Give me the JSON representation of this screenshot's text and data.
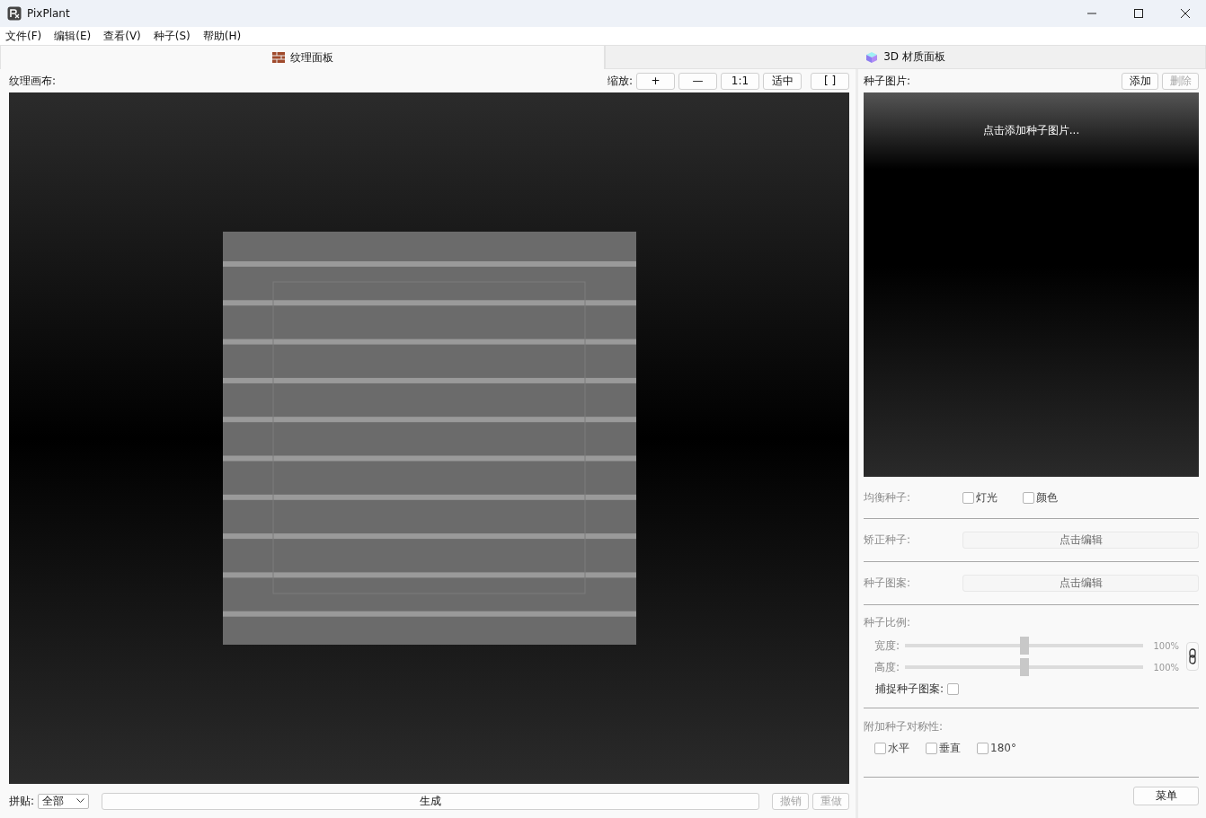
{
  "window": {
    "title": "PixPlant"
  },
  "menu": [
    "文件(F)",
    "编辑(E)",
    "查看(V)",
    "种子(S)",
    "帮助(H)"
  ],
  "panels": [
    {
      "title": "纹理面板",
      "selected": true
    },
    {
      "title": "3D 材质面板",
      "selected": false
    }
  ],
  "texture": {
    "label": "纹理画布:",
    "zoom_label": "缩放:",
    "zoom_buttons": [
      "+",
      "—",
      "1:1",
      "适中",
      "[  ]"
    ]
  },
  "bottom": {
    "tile_label": "拼贴:",
    "tile_value": "全部",
    "generate": "生成",
    "undo": {
      "label": "撤销",
      "disabled": true
    },
    "redo": {
      "label": "重做",
      "disabled": true
    }
  },
  "seed": {
    "label": "种子图片:",
    "add": {
      "label": "添加",
      "disabled": false
    },
    "delete": {
      "label": "删除",
      "disabled": true
    },
    "hint": "点击添加种子图片..."
  },
  "balance": {
    "label": "均衡种子:",
    "options": [
      {
        "label": "灯光",
        "checked": false
      },
      {
        "label": "颜色",
        "checked": false
      }
    ]
  },
  "correct": {
    "label": "矫正种子:",
    "button": "点击编辑"
  },
  "pattern": {
    "label": "种子图案:",
    "button": "点击编辑"
  },
  "scale": {
    "label": "种子比例:",
    "sliders": [
      {
        "label": "宽度:",
        "level": 0.5,
        "reading": "100%"
      },
      {
        "label": "高度:",
        "level": 0.5,
        "reading": "100%"
      }
    ],
    "linked": true,
    "capture": {
      "label": "捕捉种子图案:",
      "checked": false
    }
  },
  "symmetry": {
    "label": "附加种子对称性:",
    "options": [
      {
        "label": "水平",
        "checked": false
      },
      {
        "label": "垂直",
        "checked": false
      },
      {
        "label": "180°",
        "checked": false
      }
    ]
  },
  "menu_button": "菜单"
}
